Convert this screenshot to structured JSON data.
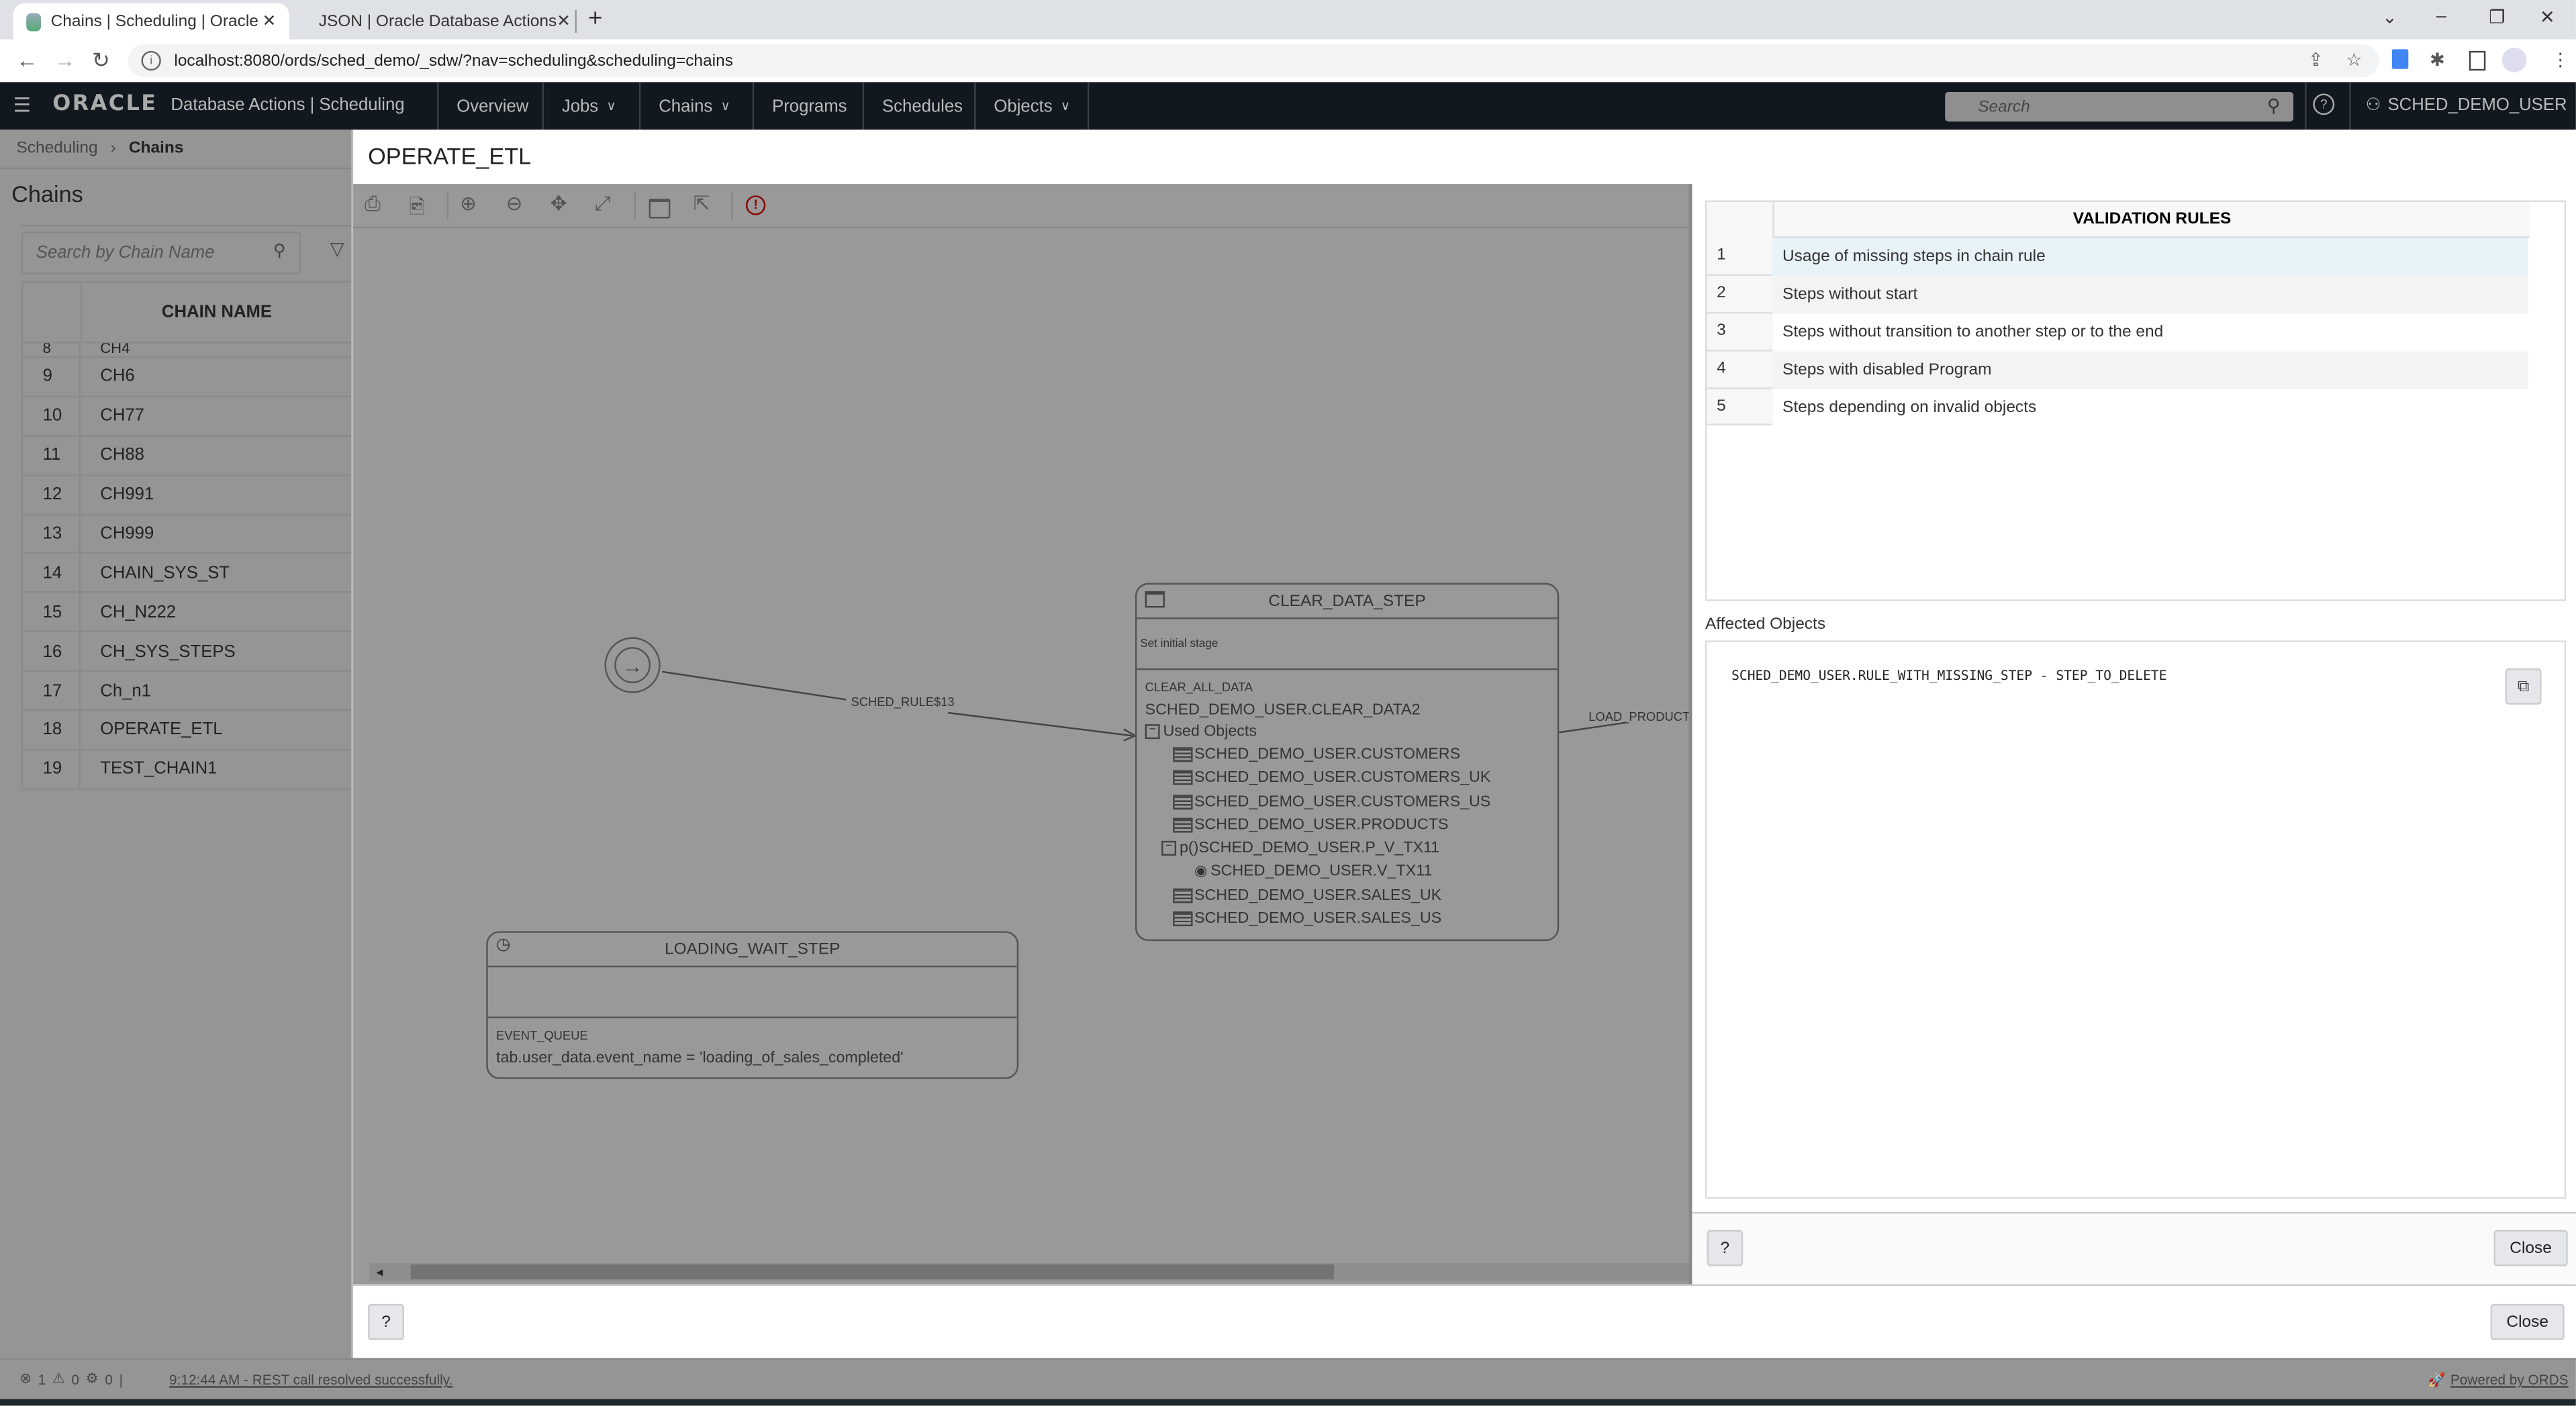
{
  "browser": {
    "tabs": [
      {
        "title": "Chains | Scheduling | Oracle Data",
        "active": true
      },
      {
        "title": "JSON | Oracle Database Actions",
        "active": false
      }
    ],
    "new_tab": "+",
    "url": "localhost:8080/ords/sched_demo/_sdw/?nav=scheduling&scheduling=chains"
  },
  "header": {
    "logo": "ORACLE",
    "app_title": "Database Actions |  Scheduling",
    "nav": [
      "Overview",
      "Jobs",
      "Chains",
      "Programs",
      "Schedules",
      "Objects"
    ],
    "nav_has_dropdown": [
      false,
      true,
      true,
      false,
      false,
      true
    ],
    "search_placeholder": "Search",
    "user": "SCHED_DEMO_USER"
  },
  "left_panel": {
    "breadcrumb": {
      "parent": "Scheduling",
      "current": "Chains"
    },
    "title": "Chains",
    "search_placeholder": "Search by Chain Name",
    "column_header": "CHAIN NAME",
    "partial_row": {
      "num": "8",
      "name": "CH4"
    },
    "rows": [
      {
        "num": "9",
        "name": "CH6"
      },
      {
        "num": "10",
        "name": "CH77"
      },
      {
        "num": "11",
        "name": "CH88"
      },
      {
        "num": "12",
        "name": "CH991"
      },
      {
        "num": "13",
        "name": "CH999"
      },
      {
        "num": "14",
        "name": "CHAIN_SYS_ST"
      },
      {
        "num": "15",
        "name": "CH_N222"
      },
      {
        "num": "16",
        "name": "CH_SYS_STEPS"
      },
      {
        "num": "17",
        "name": "Ch_n1"
      },
      {
        "num": "18",
        "name": "OPERATE_ETL"
      },
      {
        "num": "19",
        "name": "TEST_CHAIN1"
      }
    ]
  },
  "modal": {
    "title": "OPERATE_ETL",
    "toolbar": [
      "print-icon",
      "save-image-icon",
      "zoom-in-icon",
      "zoom-out-icon",
      "pan-icon",
      "fit-icon",
      "window-icon",
      "export-icon",
      "validation-icon"
    ],
    "diagram": {
      "start_rule": "SCHED_RULE$13",
      "outgoing_rule": "LOAD_PRODUCT_",
      "clear_step": {
        "title": "CLEAR_DATA_STEP",
        "description": "Set initial stage",
        "program": "CLEAR_ALL_DATA",
        "procedure": "SCHED_DEMO_USER.CLEAR_DATA2",
        "used_objects_label": "Used Objects",
        "objects": [
          {
            "type": "table",
            "name": "SCHED_DEMO_USER.CUSTOMERS"
          },
          {
            "type": "table",
            "name": "SCHED_DEMO_USER.CUSTOMERS_UK"
          },
          {
            "type": "table",
            "name": "SCHED_DEMO_USER.CUSTOMERS_US"
          },
          {
            "type": "table",
            "name": "SCHED_DEMO_USER.PRODUCTS"
          },
          {
            "type": "procedure",
            "prefix": "p()",
            "name": "SCHED_DEMO_USER.P_V_TX11"
          },
          {
            "type": "view",
            "name": "SCHED_DEMO_USER.V_TX11",
            "nested": true
          },
          {
            "type": "table",
            "name": "SCHED_DEMO_USER.SALES_UK"
          },
          {
            "type": "table",
            "name": "SCHED_DEMO_USER.SALES_US"
          }
        ]
      },
      "wait_step": {
        "title": "LOADING_WAIT_STEP",
        "queue": "EVENT_QUEUE",
        "condition": "tab.user_data.event_name = 'loading_of_sales_completed'"
      }
    },
    "validation": {
      "column_header": "VALIDATION RULES",
      "rules": [
        {
          "num": "1",
          "text": "Usage of missing steps in chain rule",
          "selected": true
        },
        {
          "num": "2",
          "text": "Steps without start"
        },
        {
          "num": "3",
          "text": "Steps without transition to another step or to the end"
        },
        {
          "num": "4",
          "text": "Steps with disabled Program"
        },
        {
          "num": "5",
          "text": "Steps depending on invalid objects"
        }
      ],
      "affected_label": "Affected Objects",
      "affected_text": "SCHED_DEMO_USER.RULE_WITH_MISSING_STEP - STEP_TO_DELETE",
      "close_label": "Close"
    },
    "close_label": "Close"
  },
  "status_bar": {
    "errors": "1",
    "warnings": "0",
    "tasks": "0",
    "message": "9:12:44 AM - REST call resolved successfully.",
    "powered_by": "Powered by ORDS"
  },
  "colors": {
    "header_bg": "#121820",
    "overlay_gray": "#999999",
    "selected_row": "#e8f2f9",
    "validation_icon": "#8b0000"
  }
}
